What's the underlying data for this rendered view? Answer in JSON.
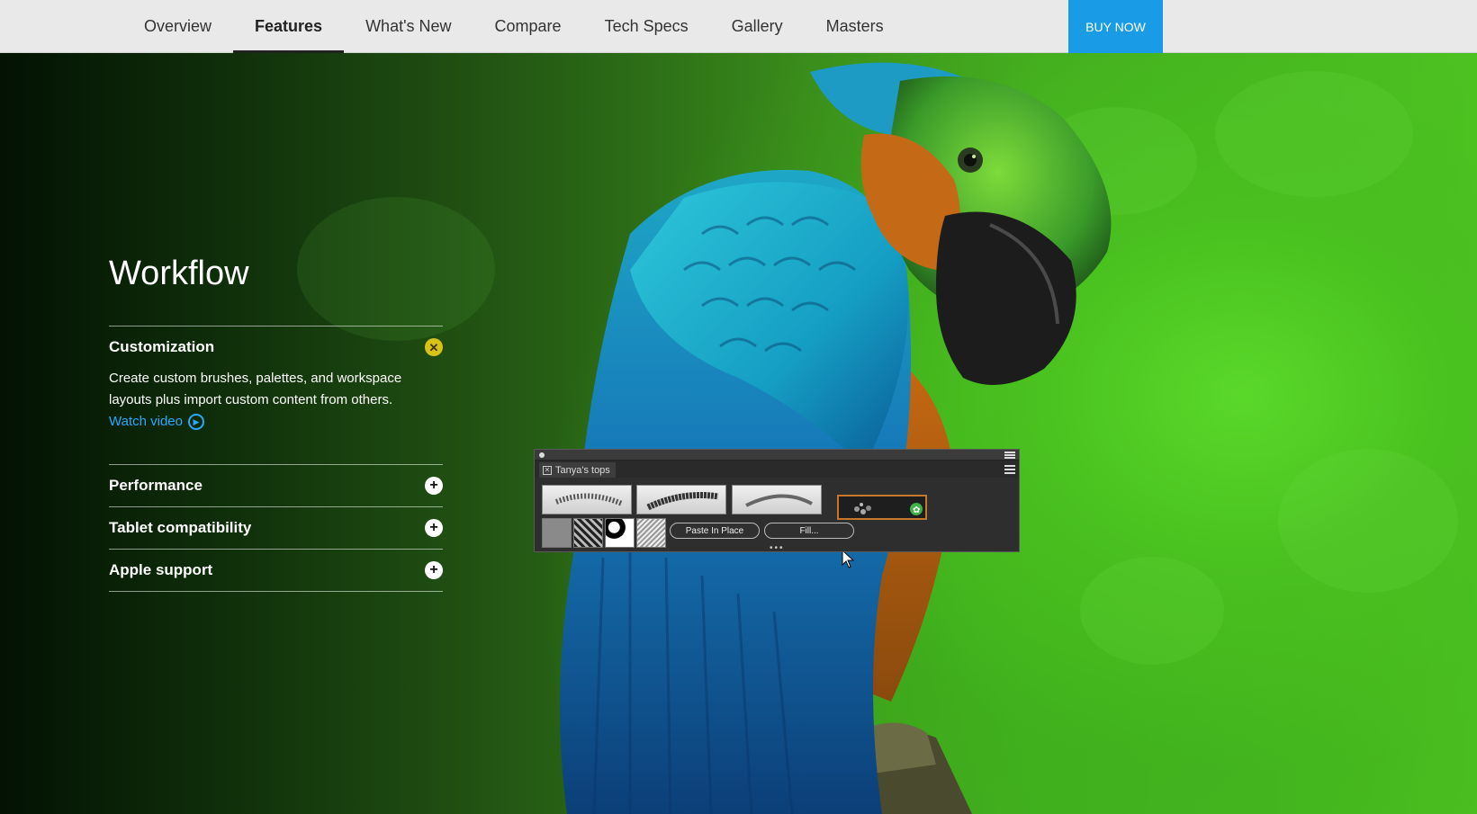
{
  "nav": {
    "items": [
      {
        "label": "Overview"
      },
      {
        "label": "Features"
      },
      {
        "label": "What's New"
      },
      {
        "label": "Compare"
      },
      {
        "label": "Tech Specs"
      },
      {
        "label": "Gallery"
      },
      {
        "label": "Masters"
      }
    ],
    "active": "Features",
    "buy_label": "BUY NOW"
  },
  "workflow": {
    "title": "Workflow",
    "sections": [
      {
        "title": "Customization",
        "expanded": true,
        "body": "Create custom brushes, palettes, and workspace layouts plus import custom content from others.",
        "link_label": "Watch video"
      },
      {
        "title": "Performance",
        "expanded": false
      },
      {
        "title": "Tablet compatibility",
        "expanded": false
      },
      {
        "title": "Apple support",
        "expanded": false
      }
    ]
  },
  "palette": {
    "tab_label": "Tanya's tops",
    "buttons": [
      "Paste In Place",
      "Fill..."
    ]
  },
  "colors": {
    "accent": "#1a9be6",
    "link": "#2aa7ff",
    "close_badge": "#d7c21a"
  }
}
